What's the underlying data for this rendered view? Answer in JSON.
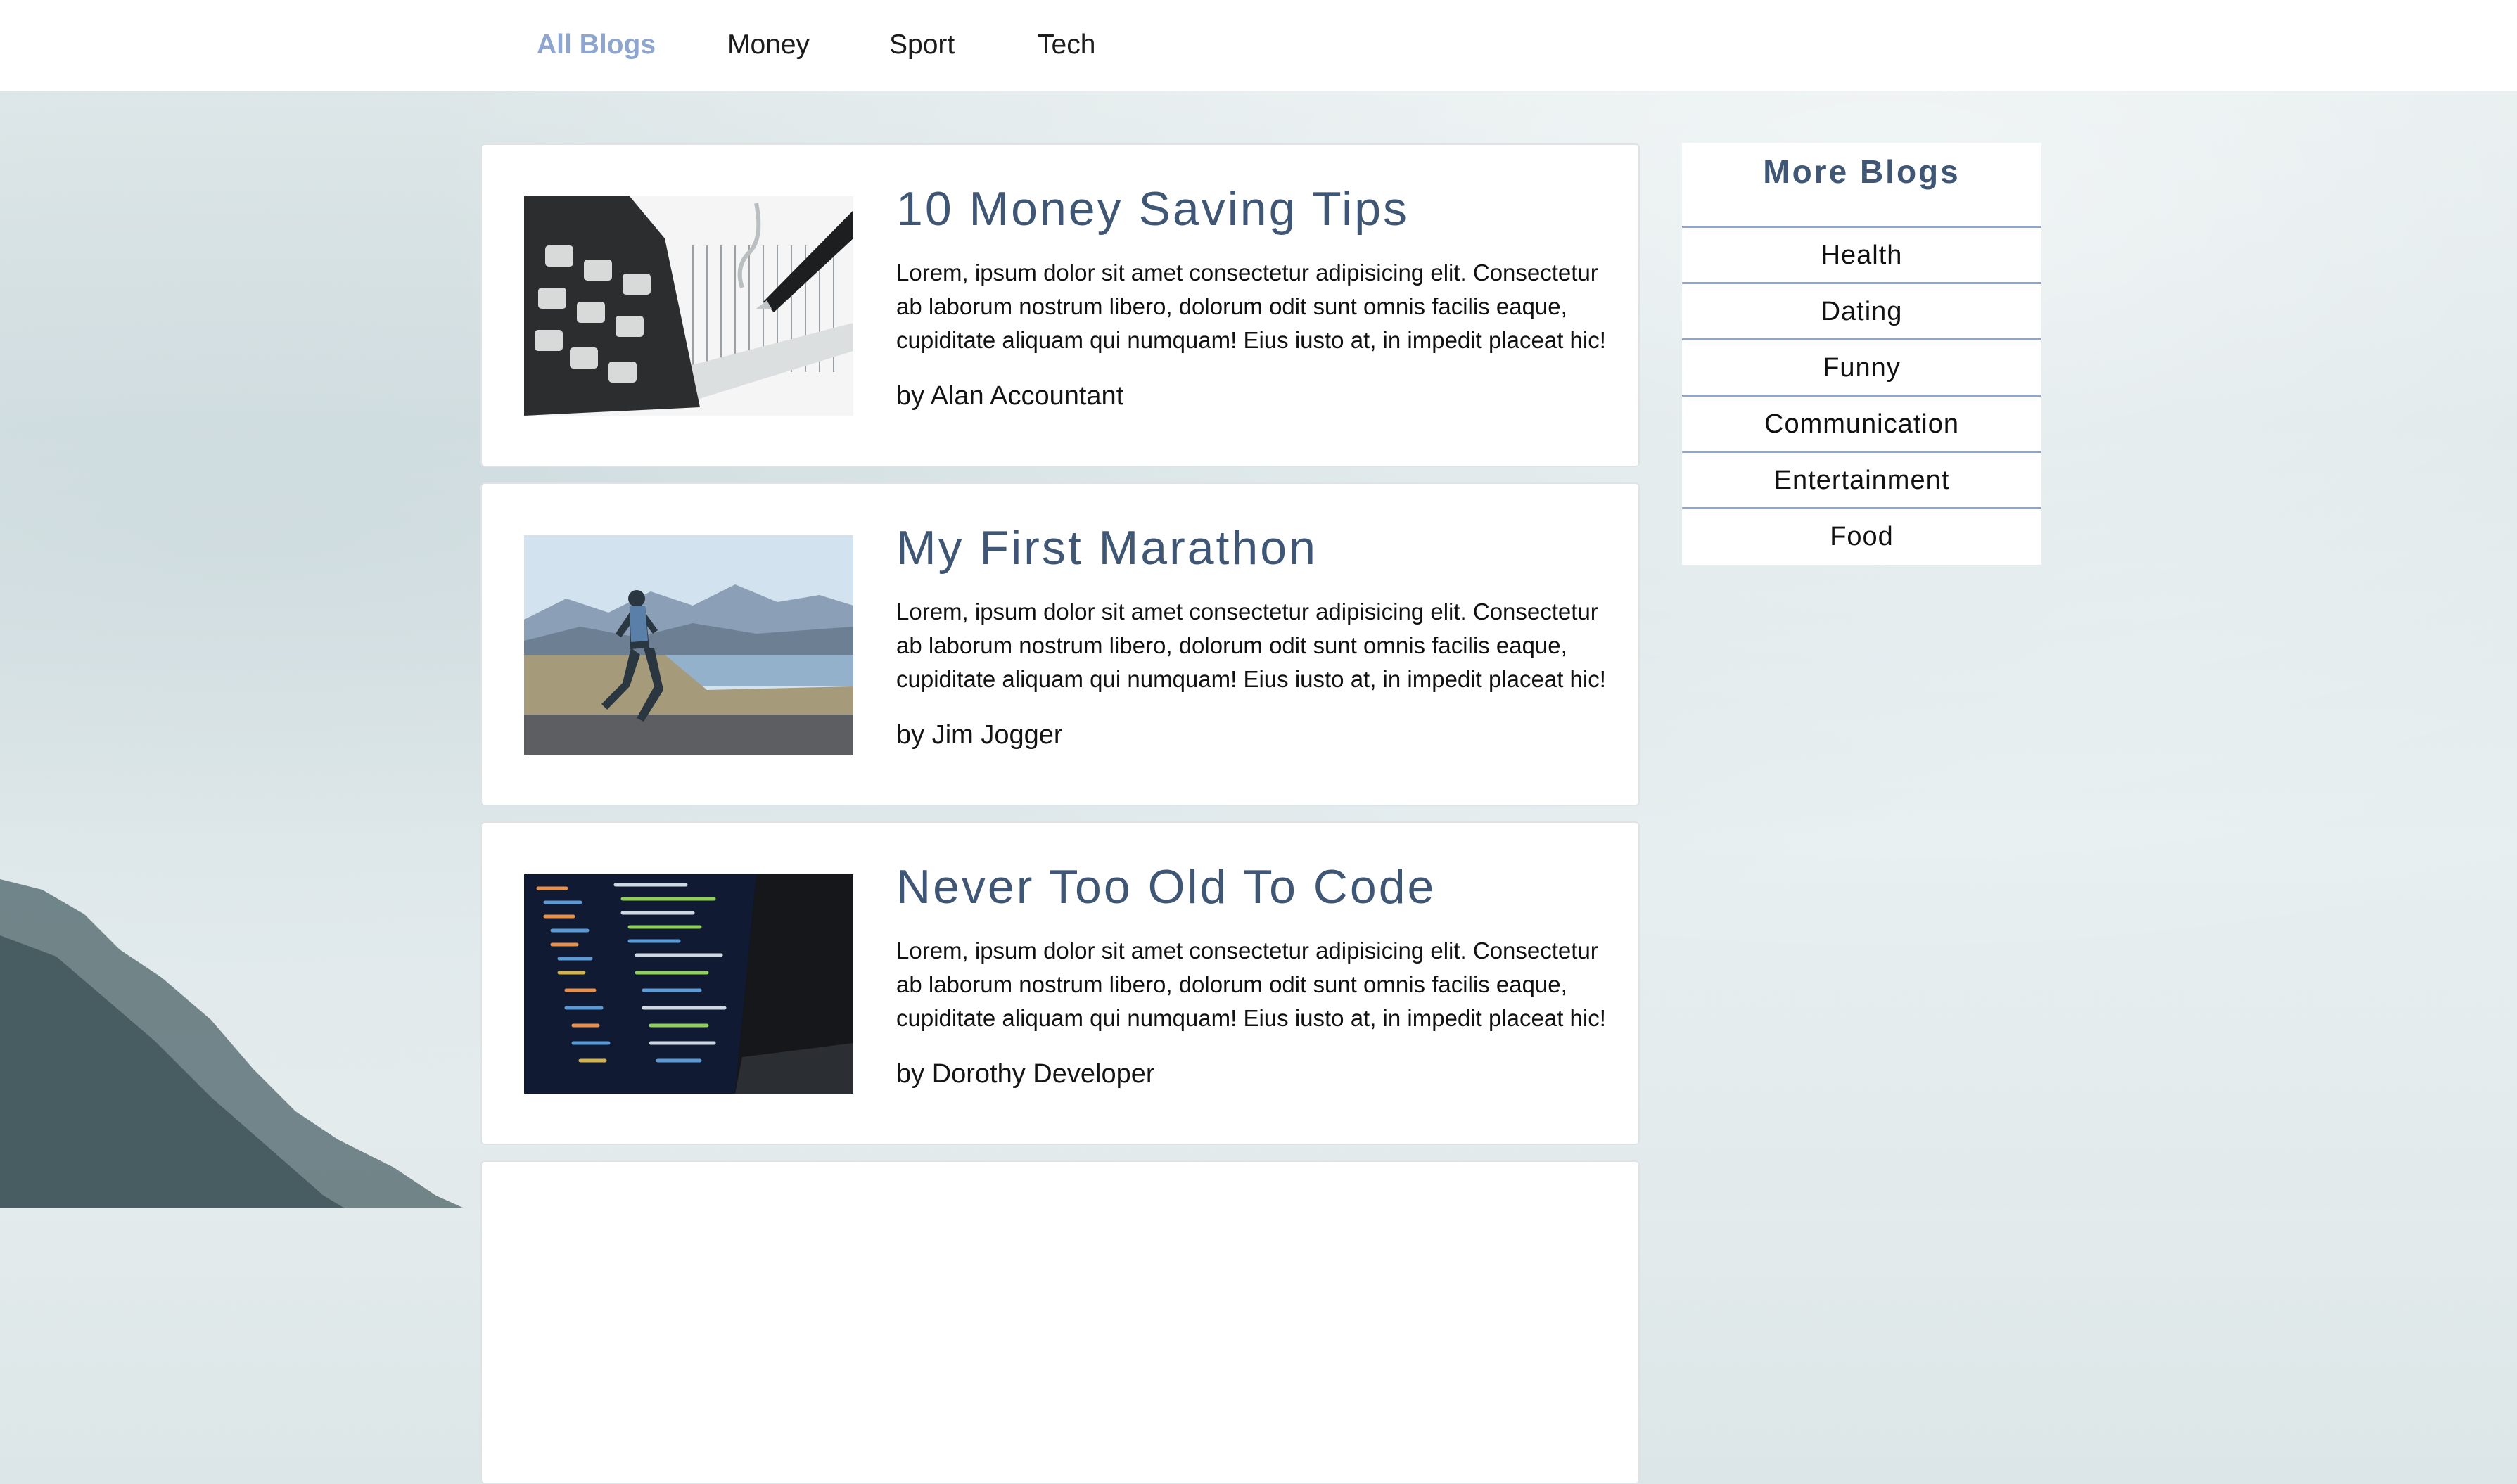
{
  "nav": {
    "items": [
      {
        "label": "All Blogs",
        "active": true
      },
      {
        "label": "Money",
        "active": false
      },
      {
        "label": "Sport",
        "active": false
      },
      {
        "label": "Tech",
        "active": false
      }
    ]
  },
  "posts": [
    {
      "title": "10 Money Saving Tips",
      "text": "Lorem, ipsum dolor sit amet consectetur adipisicing elit. Consectetur ab laborum nostrum libero, dolorum odit sunt omnis facilis eaque, cupiditate aliquam qui numquam! Eius iusto at, in impedit placeat hic!",
      "author": "by Alan Accountant",
      "image": "calculator-photo"
    },
    {
      "title": "My First Marathon",
      "text": "Lorem, ipsum dolor sit amet consectetur adipisicing elit. Consectetur ab laborum nostrum libero, dolorum odit sunt omnis facilis eaque, cupiditate aliquam qui numquam! Eius iusto at, in impedit placeat hic!",
      "author": "by Jim Jogger",
      "image": "runner-photo"
    },
    {
      "title": "Never Too Old To Code",
      "text": "Lorem, ipsum dolor sit amet consectetur adipisicing elit. Consectetur ab laborum nostrum libero, dolorum odit sunt omnis facilis eaque, cupiditate aliquam qui numquam! Eius iusto at, in impedit placeat hic!",
      "author": "by Dorothy Developer",
      "image": "code-laptop-photo"
    }
  ],
  "sidebar": {
    "title": "More Blogs",
    "items": [
      "Health",
      "Dating",
      "Funny",
      "Communication",
      "Entertainment",
      "Food"
    ]
  },
  "colors": {
    "accent": "#8ea6cf",
    "title": "#3f5674",
    "card_border": "#dfe3e6"
  }
}
